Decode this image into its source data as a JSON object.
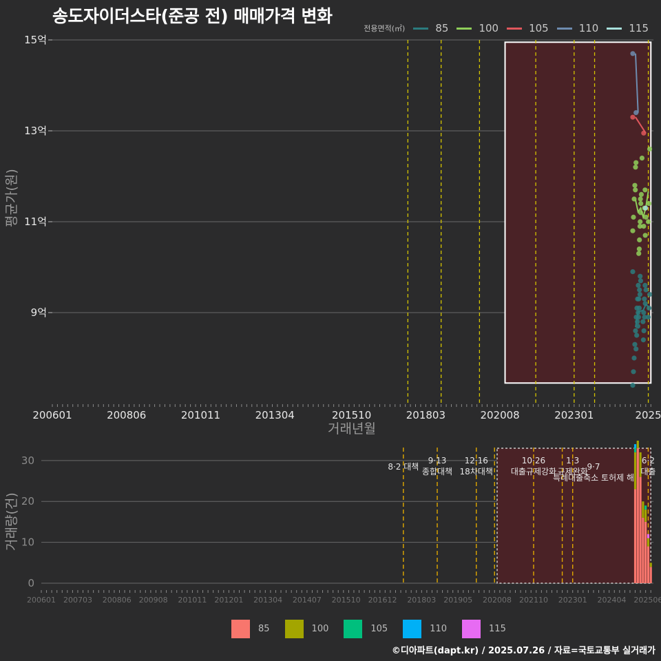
{
  "title": "송도자이더스타(준공 전) 매매가격 변화",
  "footer": "©디아파트(dapt.kr) / 2025.07.26 / 자료=국토교통부 실거래가",
  "legend_title": "전용면적(㎡)",
  "colors": {
    "background": "#2b2b2c",
    "grid": "#6a6a6a",
    "policy_line": "#d4c400",
    "highlight_fill": "#4a2226",
    "series_top": {
      "85": "#2b7b7e",
      "100": "#8fcf5a",
      "105": "#e0575c",
      "110": "#6e8caf",
      "115": "#a8e0dc"
    },
    "series_bottom": {
      "85": "#f8766d",
      "100": "#a3a500",
      "105": "#00bf7d",
      "110": "#00b0f6",
      "115": "#e76bf3"
    }
  },
  "chart_data": [
    {
      "type": "scatter",
      "panel": "price",
      "ylabel": "평균가(원)",
      "xlabel": "거래년월",
      "ylim": [
        7.0,
        15.0
      ],
      "y_ticks": [
        9,
        11,
        13,
        15
      ],
      "y_tick_labels": [
        "9억",
        "11억",
        "13억",
        "15억"
      ],
      "x_tick_labels": [
        "200601",
        "200806",
        "201011",
        "201304",
        "201510",
        "201803",
        "202008",
        "202301",
        "2025"
      ],
      "x_tick_months": [
        "2006-01",
        "2008-06",
        "2010-11",
        "2013-04",
        "2015-10",
        "2018-03",
        "2020-08",
        "2023-01",
        "2025-06"
      ],
      "xlim": [
        "2006-01",
        "2025-08"
      ],
      "grid": "horizontal",
      "legend": "top-right",
      "policy_line_months": [
        "2017-08",
        "2018-09",
        "2019-12",
        "2021-10",
        "2023-01",
        "2023-09",
        "2025-06"
      ],
      "highlight": {
        "x": [
          "2020-10",
          "2025-07"
        ],
        "y": [
          7.45,
          14.95
        ]
      },
      "series": [
        {
          "name": "85",
          "points": [
            [
              "2025-01",
              7.4
            ],
            [
              "2025-01",
              7.7
            ],
            [
              "2025-01",
              8.0
            ],
            [
              "2025-01",
              8.3
            ],
            [
              "2025-01",
              8.6
            ],
            [
              "2025-01",
              8.9
            ],
            [
              "2025-01",
              9.1
            ],
            [
              "2025-01",
              9.3
            ],
            [
              "2025-01",
              9.6
            ],
            [
              "2025-01",
              9.9
            ],
            [
              "2025-02",
              8.2
            ],
            [
              "2025-02",
              8.5
            ],
            [
              "2025-02",
              8.8
            ],
            [
              "2025-02",
              9.0
            ],
            [
              "2025-02",
              9.3
            ],
            [
              "2025-02",
              9.5
            ],
            [
              "2025-02",
              9.8
            ],
            [
              "2025-03",
              8.4
            ],
            [
              "2025-03",
              8.7
            ],
            [
              "2025-03",
              8.9
            ],
            [
              "2025-03",
              9.1
            ],
            [
              "2025-03",
              9.4
            ],
            [
              "2025-03",
              9.7
            ],
            [
              "2025-04",
              8.6
            ],
            [
              "2025-04",
              8.9
            ],
            [
              "2025-04",
              9.2
            ],
            [
              "2025-04",
              9.5
            ],
            [
              "2025-05",
              8.8
            ],
            [
              "2025-05",
              9.0
            ],
            [
              "2025-05",
              9.3
            ],
            [
              "2025-05",
              9.6
            ],
            [
              "2025-06",
              8.9
            ],
            [
              "2025-06",
              9.1
            ],
            [
              "2025-06",
              9.4
            ]
          ]
        },
        {
          "name": "100",
          "points": [
            [
              "2025-01",
              10.8
            ],
            [
              "2025-01",
              11.1
            ],
            [
              "2025-01",
              11.5
            ],
            [
              "2025-01",
              11.8
            ],
            [
              "2025-01",
              12.2
            ],
            [
              "2025-02",
              10.3
            ],
            [
              "2025-02",
              10.6
            ],
            [
              "2025-02",
              11.0
            ],
            [
              "2025-02",
              11.4
            ],
            [
              "2025-02",
              11.7
            ],
            [
              "2025-02",
              12.3
            ],
            [
              "2025-03",
              10.4
            ],
            [
              "2025-03",
              10.9
            ],
            [
              "2025-03",
              11.2
            ],
            [
              "2025-03",
              11.6
            ],
            [
              "2025-03",
              12.4
            ],
            [
              "2025-04",
              10.7
            ],
            [
              "2025-04",
              11.1
            ],
            [
              "2025-04",
              11.5
            ],
            [
              "2025-05",
              10.9
            ],
            [
              "2025-05",
              11.3
            ],
            [
              "2025-05",
              11.7
            ],
            [
              "2025-06",
              11.0
            ],
            [
              "2025-06",
              11.4
            ],
            [
              "2025-06",
              12.6
            ]
          ]
        },
        {
          "name": "105",
          "points": [
            [
              "2025-01",
              13.3
            ],
            [
              "2025-05",
              12.95
            ]
          ]
        },
        {
          "name": "110",
          "points": [
            [
              "2025-01",
              14.7
            ],
            [
              "2025-02",
              13.4
            ]
          ]
        },
        {
          "name": "115",
          "points": [
            [
              "2025-06",
              11.3
            ]
          ]
        }
      ]
    },
    {
      "type": "bar",
      "panel": "volume",
      "stacked": true,
      "ylabel": "거래량(건)",
      "ylim": [
        0,
        33
      ],
      "y_ticks": [
        0,
        10,
        20,
        30
      ],
      "y_tick_labels": [
        "0",
        "10",
        "20",
        "30"
      ],
      "x_tick_labels": [
        "200601",
        "200703",
        "200806",
        "200908",
        "201011",
        "201201",
        "201304",
        "201407",
        "201510",
        "201612",
        "201803",
        "201905",
        "202008",
        "202110",
        "202301",
        "202404",
        "202506"
      ],
      "x_tick_months": [
        "2006-01",
        "2007-03",
        "2008-06",
        "2009-08",
        "2010-11",
        "2012-01",
        "2013-04",
        "2014-07",
        "2015-10",
        "2016-12",
        "2018-03",
        "2019-05",
        "2020-08",
        "2021-10",
        "2023-01",
        "2024-04",
        "2025-06"
      ],
      "xlim": [
        "2006-01",
        "2025-08"
      ],
      "grid": "horizontal",
      "legend": "bottom",
      "policy_line_months": [
        "2017-08",
        "2018-09",
        "2019-12",
        "2020-07",
        "2021-10",
        "2022-09",
        "2023-01",
        "2025-06"
      ],
      "highlight": {
        "x": [
          "2020-08",
          "2025-07"
        ],
        "y": [
          0,
          33
        ]
      },
      "annotations": [
        {
          "month": "2017-08",
          "lines": [
            "8·2 대책"
          ],
          "row": 1
        },
        {
          "month": "2018-09",
          "lines": [
            "9·13",
            "종합대책"
          ],
          "row": 0
        },
        {
          "month": "2019-12",
          "lines": [
            "12·16",
            "18차대책"
          ],
          "row": 0
        },
        {
          "month": "2021-10",
          "lines": [
            "10·26",
            "대출규제강화"
          ],
          "row": 0
        },
        {
          "month": "2023-01",
          "lines": [
            "1·3",
            "규제완화"
          ],
          "row": 0
        },
        {
          "month": "2023-09",
          "lines": [
            "9·7",
            "특례대출축소 토허제 해"
          ],
          "row": 1
        },
        {
          "month": "2025-06",
          "lines": [
            "6·2",
            "대출"
          ],
          "row": 0
        }
      ],
      "categories": [
        "2025-01",
        "2025-02",
        "2025-03",
        "2025-04",
        "2025-05",
        "2025-06",
        "2025-07"
      ],
      "series": [
        {
          "name": "85",
          "values": [
            23,
            33,
            26,
            16,
            15,
            9,
            4
          ]
        },
        {
          "name": "100",
          "values": [
            9,
            8,
            6,
            4,
            3,
            2,
            1
          ]
        },
        {
          "name": "105",
          "values": [
            1,
            0,
            0,
            0,
            1,
            0,
            0
          ]
        },
        {
          "name": "110",
          "values": [
            1,
            1,
            0,
            0,
            0,
            0,
            0
          ]
        },
        {
          "name": "115",
          "values": [
            0,
            0,
            0,
            0,
            0,
            1,
            0
          ]
        }
      ]
    }
  ]
}
